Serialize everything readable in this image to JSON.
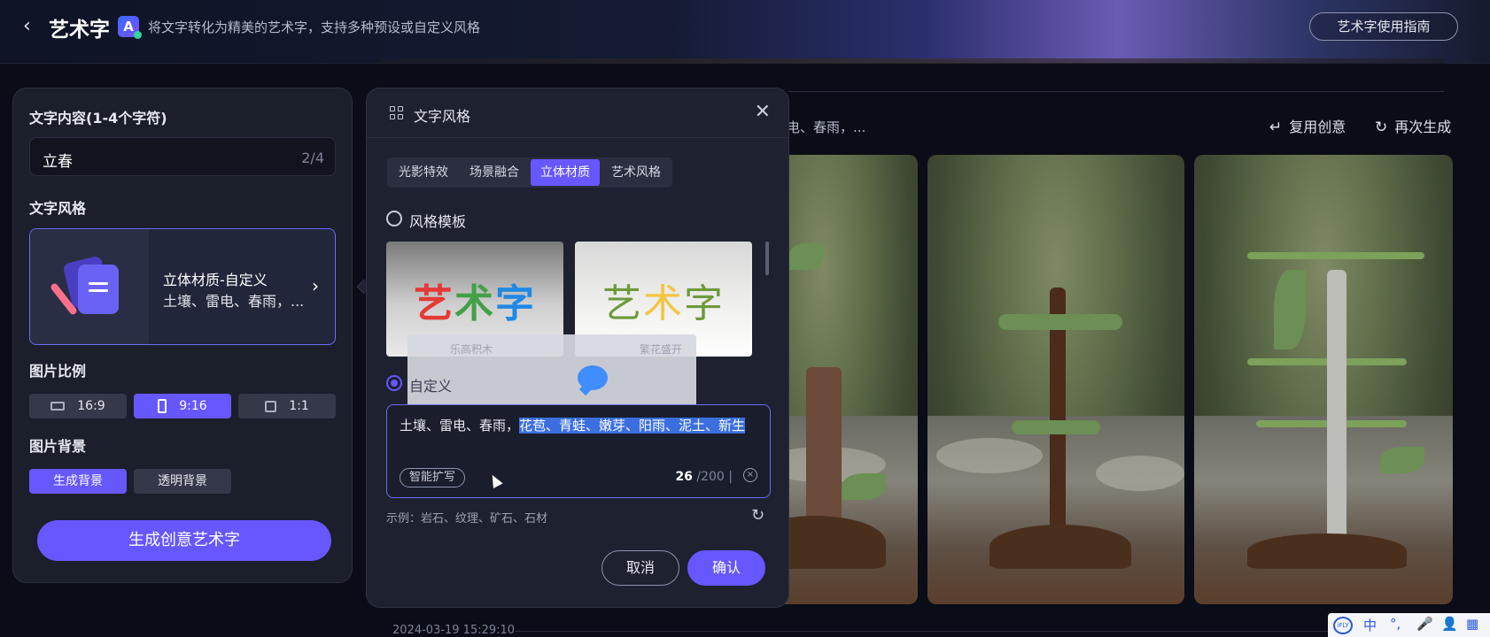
{
  "header": {
    "back": "‹",
    "title": "艺术字",
    "logo": "A",
    "description": "将文字转化为精美的艺术字，支持多种预设或自定义风格",
    "guide_button": "艺术字使用指南"
  },
  "left_panel": {
    "text_label": "文字内容(1-4个字符)",
    "text_value": "立春",
    "text_count": "2/4",
    "style_label": "文字风格",
    "style_name": "立体材质-自定义",
    "style_desc": "土壤、雷电、春雨，...",
    "ratio_label": "图片比例",
    "ratios": [
      "16:9",
      "9:16",
      "1:1"
    ],
    "ratio_selected": "9:16",
    "bg_label": "图片背景",
    "bg_options": [
      "生成背景",
      "透明背景"
    ],
    "bg_selected": "生成背景",
    "generate_button": "生成创意艺术字"
  },
  "results": {
    "prompt_tail": "电、春雨，...",
    "reuse": "复用创意",
    "regenerate": "再次生成",
    "timestamp": "2024-03-19 15:29:10"
  },
  "modal": {
    "title": "文字风格",
    "tabs": [
      "光影特效",
      "场景融合",
      "立体材质",
      "艺术风格"
    ],
    "active_tab": "立体材质",
    "template_label": "风格模板",
    "templates": [
      {
        "art": [
          "艺",
          "术",
          "字"
        ],
        "caption": "乐高积木"
      },
      {
        "art": [
          "艺",
          "术",
          "字"
        ],
        "caption": "繁花盛开"
      }
    ],
    "custom_label": "自定义",
    "custom_text_plain": "土壤、雷电、春雨，",
    "custom_text_selected": "花苞、青蛙、嫩芽、阳雨、泥土、新生",
    "smart_expand": "智能扩写",
    "count_value": "26",
    "count_max": "/200",
    "example": "示例：岩石、纹理、矿石、石材",
    "cancel": "取消",
    "confirm": "确认"
  },
  "ime": {
    "logo": "iFLY",
    "lang": "中",
    "punct": "°,",
    "mic": "🎤",
    "user": "👤",
    "grid": "▦"
  },
  "colors": {
    "accent": "#6657ff",
    "panel": "#1b1f2c",
    "modal": "#1d2130",
    "selection": "#3b6fe0"
  }
}
